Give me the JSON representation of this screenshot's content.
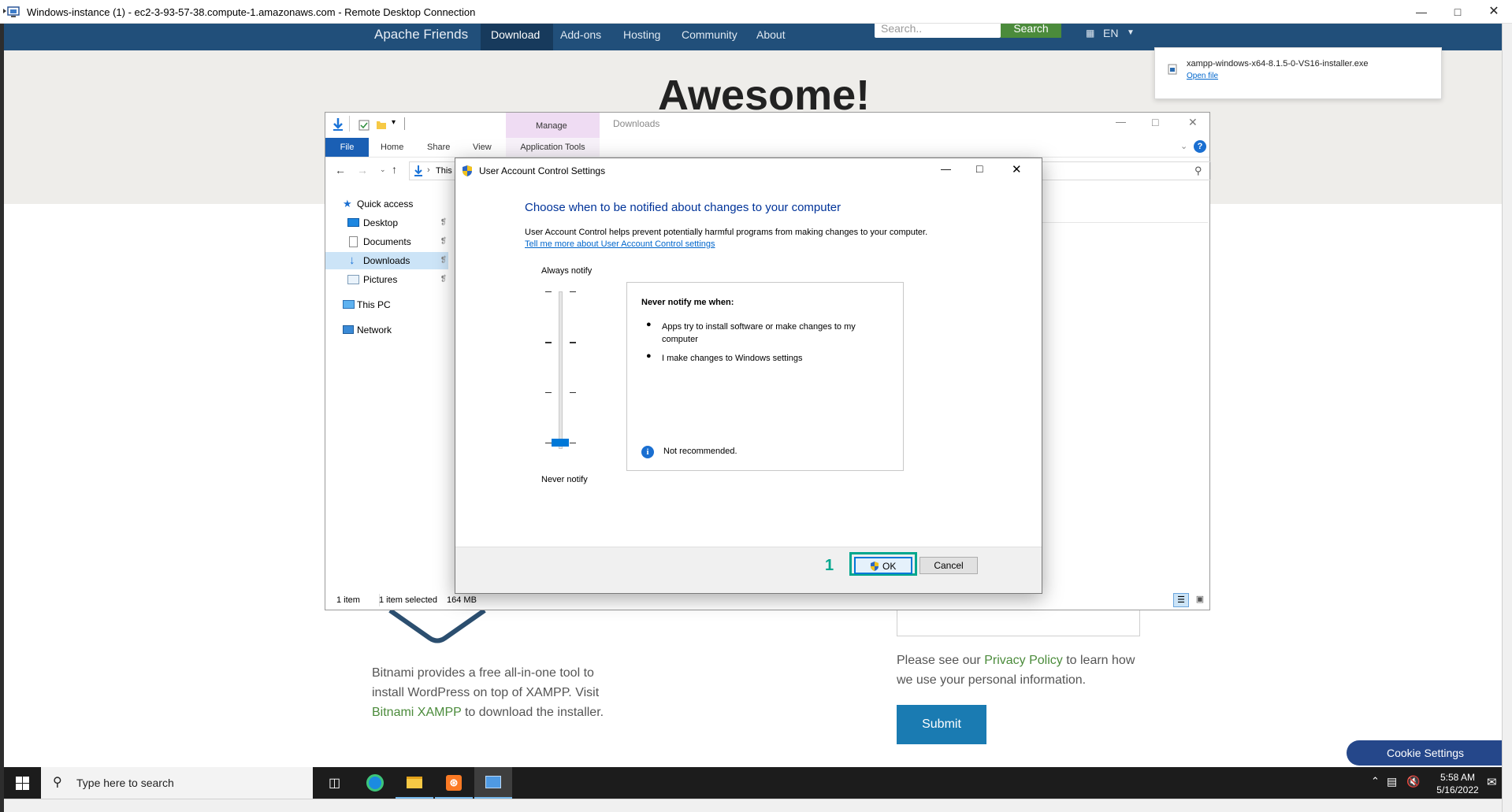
{
  "rdp": {
    "title": "Windows-instance (1) - ec2-3-93-57-38.compute-1.amazonaws.com - Remote Desktop Connection"
  },
  "website": {
    "nav": {
      "brand": "Apache Friends",
      "items": [
        "Download",
        "Add-ons",
        "Hosting",
        "Community",
        "About"
      ],
      "search_placeholder": "Search..",
      "search_button": "Search",
      "language": "EN"
    },
    "heading": "Awesome!",
    "bitnami_text_1": "Bitnami provides a free all-in-one tool to",
    "bitnami_text_2": "install WordPress on top of XAMPP. Visit",
    "bitnami_link": "Bitnami XAMPP",
    "bitnami_text_3": " to download the installer.",
    "privacy_text_1": "Please see our ",
    "privacy_link": "Privacy Policy",
    "privacy_text_2": " to learn how",
    "privacy_text_3": "we use your personal information.",
    "submit_label": "Submit",
    "cookie_label": "Cookie Settings"
  },
  "download_popup": {
    "filename": "xampp-windows-x64-8.1.5-0-VS16-installer.exe",
    "open_file": "Open file"
  },
  "explorer": {
    "contextual_group": "Manage",
    "window_title": "Downloads",
    "tabs": [
      "File",
      "Home",
      "Share",
      "View",
      "Application Tools"
    ],
    "breadcrumb": "This",
    "nav_items": [
      {
        "label": "Quick access"
      },
      {
        "label": "Desktop"
      },
      {
        "label": "Documents"
      },
      {
        "label": "Downloads"
      },
      {
        "label": "Pictures"
      },
      {
        "label": "This PC"
      },
      {
        "label": "Network"
      }
    ],
    "status_items": "1 item",
    "status_selected": "1 item selected",
    "status_size": "164 MB"
  },
  "uac": {
    "title": "User Account Control Settings",
    "heading": "Choose when to be notified about changes to your computer",
    "description": "User Account Control helps prevent potentially harmful programs from making changes to your computer.",
    "learn_more": "Tell me more about User Account Control settings",
    "slider_top_label": "Always notify",
    "slider_bottom_label": "Never notify",
    "slider_level": 0,
    "slider_levels": 4,
    "info_title": "Never notify me when:",
    "bullets": [
      "Apps try to install software or make changes to my computer",
      "I make changes to Windows settings"
    ],
    "note": "Not recommended.",
    "ok_label": "OK",
    "cancel_label": "Cancel",
    "step_marker": "1",
    "highlight_color": "#00a78e"
  },
  "taskbar": {
    "search_placeholder": "Type here to search",
    "time": "5:58 AM",
    "date": "5/16/2022"
  },
  "colors": {
    "site_nav": "#214f7a",
    "site_green": "#4b8b3b",
    "uac_heading": "#003399",
    "link": "#0066cc",
    "submit": "#1a7bb2",
    "cookie": "#25478a"
  }
}
